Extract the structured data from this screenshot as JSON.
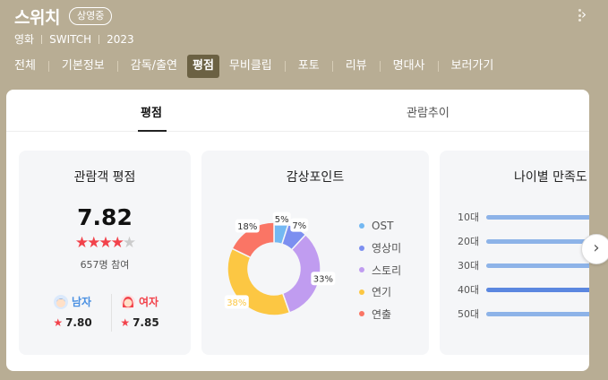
{
  "header": {
    "title": "스위치",
    "badge": "상영중",
    "meta": [
      "영화",
      "SWITCH",
      "2023"
    ]
  },
  "nav": {
    "items": [
      "전체",
      "기본정보",
      "감독/출연",
      "평점",
      "무비클립",
      "포토",
      "리뷰",
      "명대사",
      "보러가기"
    ],
    "active": "평점"
  },
  "tabs": {
    "items": [
      "평점",
      "관람추이"
    ],
    "active": "평점"
  },
  "rating_card": {
    "title": "관람객 평점",
    "score": "7.82",
    "stars_filled": 4,
    "stars_total": 5,
    "participants": "657명 참여",
    "male_label": "남자",
    "male_score": "7.80",
    "female_label": "여자",
    "female_score": "7.85",
    "male_color": "#4a90e2",
    "female_color": "#f2424b"
  },
  "points_card": {
    "title": "감상포인트",
    "segments": [
      {
        "name": "OST",
        "percent": 5,
        "label": "5%",
        "color": "#73b8f2"
      },
      {
        "name": "영상미",
        "percent": 7,
        "label": "7%",
        "color": "#7c8ff0"
      },
      {
        "name": "스토리",
        "percent": 33,
        "label": "33%",
        "color": "#c09cf0"
      },
      {
        "name": "연기",
        "percent": 38,
        "label": "38%",
        "color": "#fcc743"
      },
      {
        "name": "연출",
        "percent": 18,
        "label": "18%",
        "color": "#fa7565"
      }
    ]
  },
  "age_card": {
    "title": "나이별 만족도",
    "rows": [
      {
        "label": "10대",
        "fraction": 0.93,
        "color": "#8db3e8"
      },
      {
        "label": "20대",
        "fraction": 0.94,
        "color": "#8db3e8"
      },
      {
        "label": "30대",
        "fraction": 0.96,
        "color": "#8db3e8"
      },
      {
        "label": "40대",
        "fraction": 0.97,
        "color": "#5b87e0"
      },
      {
        "label": "50대",
        "fraction": 0.95,
        "color": "#8db3e8"
      }
    ]
  },
  "icons": {
    "more": "more-vertical-icon",
    "nav_next": "chevron-right-icon",
    "carousel_next": "chevron-right-icon",
    "male": "male-avatar-icon",
    "female": "female-avatar-icon",
    "star": "star-icon"
  },
  "colors": {
    "header_bg": "#b8ad94",
    "active_nav_bg": "#6b6143",
    "star": "#f2424b"
  }
}
